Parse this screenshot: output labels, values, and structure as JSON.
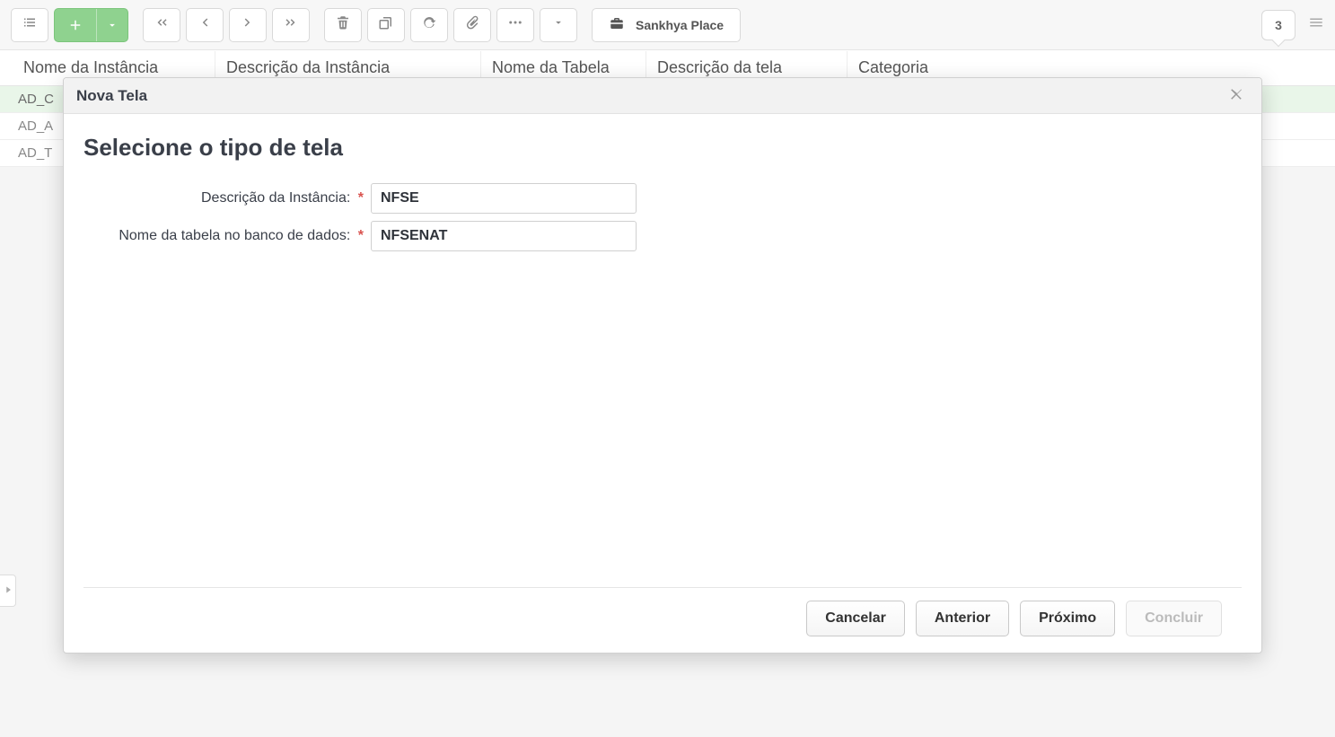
{
  "toolbar": {
    "place_label": "Sankhya Place",
    "badge_count": "3"
  },
  "grid": {
    "headers": {
      "c1": "Nome da Instância",
      "c2": "Descrição da Instância",
      "c3": "Nome da Tabela",
      "c4": "Descrição da tela",
      "c5": "Categoria"
    },
    "rows": [
      {
        "c1": "AD_C"
      },
      {
        "c1": "AD_A"
      },
      {
        "c1": "AD_T"
      }
    ]
  },
  "modal": {
    "title": "Nova Tela",
    "section_title": "Selecione o tipo de tela",
    "fields": {
      "instance_desc": {
        "label": "Descrição da Instância:",
        "value": "NFSE"
      },
      "db_table_name": {
        "label": "Nome da tabela no banco de dados:",
        "value": "NFSENAT"
      }
    },
    "buttons": {
      "cancel": "Cancelar",
      "prev": "Anterior",
      "next": "Próximo",
      "finish": "Concluir"
    }
  }
}
